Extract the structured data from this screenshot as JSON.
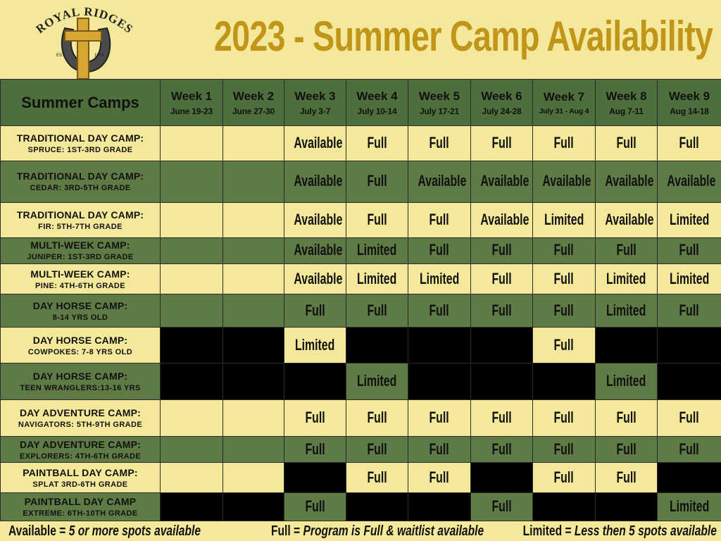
{
  "logo": {
    "text": "ROYAL RIDGES",
    "est": "EST.",
    "year": "1978"
  },
  "title": "2023 - Summer Camp Availability",
  "table": {
    "corner_label": "Summer Camps",
    "weeks": [
      {
        "name": "Week 1",
        "dates": "June 19-23"
      },
      {
        "name": "Week 2",
        "dates": "June 27-30"
      },
      {
        "name": "Week 3",
        "dates": "July 3-7"
      },
      {
        "name": "Week 4",
        "dates": "July 10-14"
      },
      {
        "name": "Week 5",
        "dates": "July 17-21"
      },
      {
        "name": "Week 6",
        "dates": "July 24-28"
      },
      {
        "name": "Week 7",
        "dates": "July 31 - Aug 4"
      },
      {
        "name": "Week 8",
        "dates": "Aug 7-11"
      },
      {
        "name": "Week 9",
        "dates": "Aug 14-18"
      }
    ],
    "rows": [
      {
        "type": "TRADITIONAL DAY CAMP:",
        "sub": "SPRUCE: 1ST-3RD GRADE",
        "cells": [
          [
            "y",
            ""
          ],
          [
            "y",
            ""
          ],
          [
            "y",
            "Available"
          ],
          [
            "y",
            "Full"
          ],
          [
            "y",
            "Full"
          ],
          [
            "y",
            "Full"
          ],
          [
            "y",
            "Full"
          ],
          [
            "y",
            "Full"
          ],
          [
            "y",
            "Full"
          ]
        ]
      },
      {
        "type": "TRADITIONAL DAY CAMP:",
        "sub": "CEDAR: 3RD-5TH GRADE",
        "cells": [
          [
            "g",
            ""
          ],
          [
            "g",
            ""
          ],
          [
            "g",
            "Available"
          ],
          [
            "g",
            "Full"
          ],
          [
            "g",
            "Available"
          ],
          [
            "g",
            "Available"
          ],
          [
            "g",
            "Available"
          ],
          [
            "g",
            "Available"
          ],
          [
            "g",
            "Available"
          ]
        ]
      },
      {
        "type": "TRADITIONAL DAY CAMP:",
        "sub": "FIR: 5TH-7TH GRADE",
        "cells": [
          [
            "y",
            ""
          ],
          [
            "y",
            ""
          ],
          [
            "y",
            "Available"
          ],
          [
            "y",
            "Full"
          ],
          [
            "y",
            "Full"
          ],
          [
            "y",
            "Available"
          ],
          [
            "y",
            "Limited"
          ],
          [
            "y",
            "Available"
          ],
          [
            "y",
            "Limited"
          ]
        ]
      },
      {
        "type": "MULTI-WEEK CAMP:",
        "sub": "JUNIPER: 1ST-3RD GRADE",
        "cells": [
          [
            "g",
            ""
          ],
          [
            "g",
            ""
          ],
          [
            "g",
            "Available"
          ],
          [
            "g",
            "Limited"
          ],
          [
            "g",
            "Full"
          ],
          [
            "g",
            "Full"
          ],
          [
            "g",
            "Full"
          ],
          [
            "g",
            "Full"
          ],
          [
            "g",
            "Full"
          ]
        ]
      },
      {
        "type": "MULTI-WEEK CAMP:",
        "sub": "PINE: 4TH-6TH GRADE",
        "cells": [
          [
            "y",
            ""
          ],
          [
            "y",
            ""
          ],
          [
            "y",
            "Available"
          ],
          [
            "y",
            "Limited"
          ],
          [
            "y",
            "Limited"
          ],
          [
            "y",
            "Full"
          ],
          [
            "y",
            "Full"
          ],
          [
            "y",
            "Limited"
          ],
          [
            "y",
            "Limited"
          ]
        ]
      },
      {
        "type": "DAY HORSE CAMP:",
        "sub": "8-14 YRS OLD",
        "cells": [
          [
            "g",
            ""
          ],
          [
            "g",
            ""
          ],
          [
            "g",
            "Full"
          ],
          [
            "g",
            "Full"
          ],
          [
            "g",
            "Full"
          ],
          [
            "g",
            "Full"
          ],
          [
            "g",
            "Full"
          ],
          [
            "g",
            "Limited"
          ],
          [
            "g",
            "Full"
          ]
        ]
      },
      {
        "type": "DAY HORSE CAMP:",
        "sub": "COWPOKES: 7-8 YRS OLD",
        "cells": [
          [
            "b",
            ""
          ],
          [
            "b",
            ""
          ],
          [
            "y",
            "Limited"
          ],
          [
            "b",
            ""
          ],
          [
            "b",
            ""
          ],
          [
            "b",
            ""
          ],
          [
            "y",
            "Full"
          ],
          [
            "b",
            ""
          ],
          [
            "b",
            ""
          ]
        ]
      },
      {
        "type": "DAY HORSE CAMP:",
        "sub": "TEEN WRANGLERS:13-16 YRS",
        "cells": [
          [
            "b",
            ""
          ],
          [
            "b",
            ""
          ],
          [
            "b",
            ""
          ],
          [
            "g",
            "Limited"
          ],
          [
            "b",
            ""
          ],
          [
            "b",
            ""
          ],
          [
            "b",
            ""
          ],
          [
            "g",
            "Limited"
          ],
          [
            "b",
            ""
          ]
        ]
      },
      {
        "type": "DAY ADVENTURE CAMP:",
        "sub": "NAVIGATORS: 5TH-9TH GRADE",
        "cells": [
          [
            "y",
            ""
          ],
          [
            "y",
            ""
          ],
          [
            "y",
            "Full"
          ],
          [
            "y",
            "Full"
          ],
          [
            "y",
            "Full"
          ],
          [
            "y",
            "Full"
          ],
          [
            "y",
            "Full"
          ],
          [
            "y",
            "Full"
          ],
          [
            "y",
            "Full"
          ]
        ]
      },
      {
        "type": "DAY ADVENTURE CAMP:",
        "sub": "EXPLORERS: 4TH-6TH GRADE",
        "cells": [
          [
            "g",
            ""
          ],
          [
            "g",
            ""
          ],
          [
            "g",
            "Full"
          ],
          [
            "g",
            "Full"
          ],
          [
            "g",
            "Full"
          ],
          [
            "g",
            "Full"
          ],
          [
            "g",
            "Full"
          ],
          [
            "g",
            "Full"
          ],
          [
            "g",
            "Full"
          ]
        ]
      },
      {
        "type": "PAINTBALL DAY CAMP:",
        "sub": "SPLAT 3RD-6TH GRADE",
        "cells": [
          [
            "y",
            ""
          ],
          [
            "y",
            ""
          ],
          [
            "b",
            ""
          ],
          [
            "y",
            "Full"
          ],
          [
            "y",
            "Full"
          ],
          [
            "b",
            ""
          ],
          [
            "y",
            "Full"
          ],
          [
            "y",
            "Full"
          ],
          [
            "b",
            ""
          ]
        ]
      },
      {
        "type": "PAINTBALL DAY CAMP",
        "sub": "EXTREME: 6TH-10TH GRADE",
        "cells": [
          [
            "b",
            ""
          ],
          [
            "b",
            ""
          ],
          [
            "g",
            "Full"
          ],
          [
            "b",
            ""
          ],
          [
            "b",
            ""
          ],
          [
            "g",
            "Full"
          ],
          [
            "b",
            ""
          ],
          [
            "b",
            ""
          ],
          [
            "g",
            "Limited"
          ]
        ]
      }
    ]
  },
  "legend": [
    {
      "term": "Available",
      "desc": "5 or more spots available"
    },
    {
      "term": "Full",
      "desc": "Program is Full & waitlist available"
    },
    {
      "term": "Limited",
      "desc": "Less then 5 spots available"
    }
  ],
  "colors": {
    "yellow": "#f4e99a",
    "green": "#5e7a45",
    "header_green": "#4e6e3b",
    "title_gold": "#c0951a",
    "blocked": "#000000"
  }
}
